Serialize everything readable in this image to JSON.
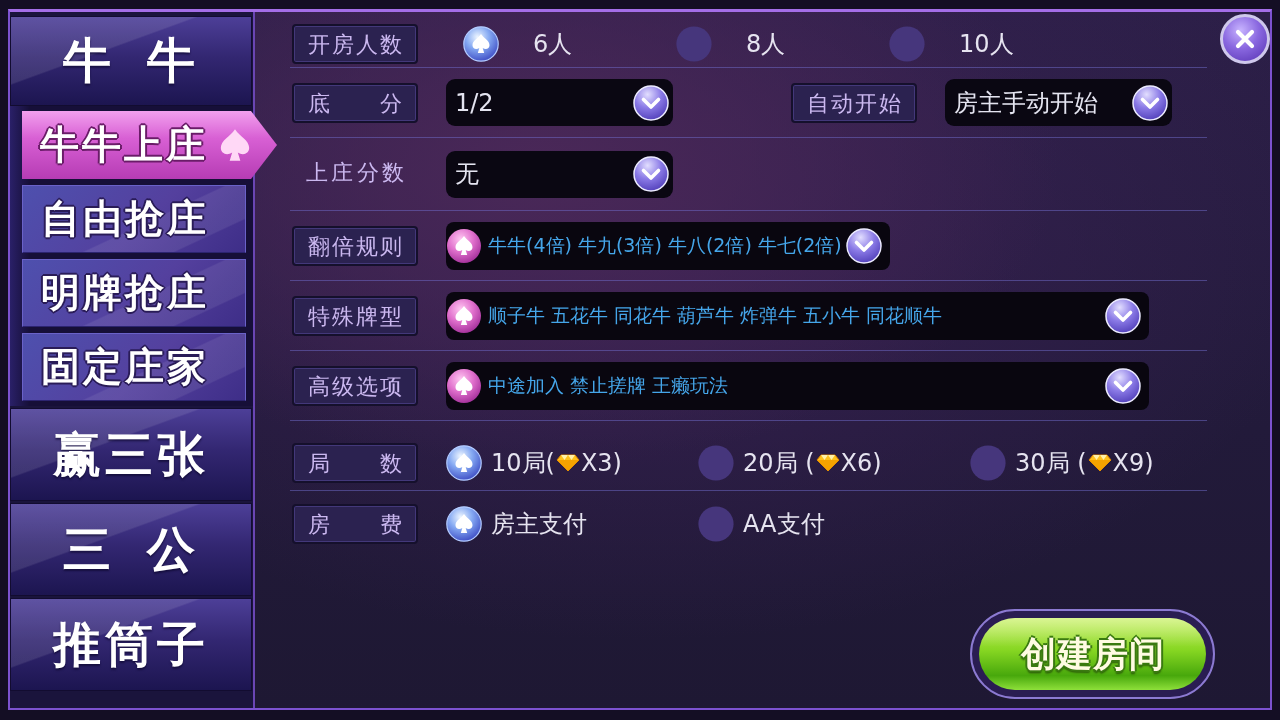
{
  "sidebar": [
    {
      "label": "牛 牛",
      "modes": [
        {
          "label": "牛牛上庄",
          "selected": true
        },
        {
          "label": "自由抢庄",
          "selected": false
        },
        {
          "label": "明牌抢庄",
          "selected": false
        },
        {
          "label": "固定庄家",
          "selected": false
        }
      ]
    },
    {
      "label": "赢三张"
    },
    {
      "label": "三 公"
    },
    {
      "label": "推筒子"
    }
  ],
  "settings": [
    {
      "fields": [
        {
          "kind": "radio",
          "label": "开房人数",
          "framed": true,
          "options": [
            {
              "label": "6人",
              "selected": true
            },
            {
              "label": "8人",
              "selected": false
            },
            {
              "label": "10人",
              "selected": false
            }
          ]
        }
      ]
    },
    {
      "fields": [
        {
          "kind": "select",
          "label": "底 分",
          "framed": true,
          "value": "1/2"
        },
        {
          "kind": "select",
          "label": "自动开始",
          "framed": true,
          "value": "房主手动开始"
        }
      ]
    },
    {
      "fields": [
        {
          "kind": "select",
          "label": "上庄分数",
          "framed": false,
          "value": "无"
        }
      ]
    },
    {
      "fields": [
        {
          "kind": "multi",
          "label": "翻倍规则",
          "framed": true,
          "stretch": false,
          "value": "牛牛(4倍) 牛九(3倍) 牛八(2倍) 牛七(2倍)"
        }
      ]
    },
    {
      "fields": [
        {
          "kind": "multi",
          "label": "特殊牌型",
          "framed": true,
          "stretch": true,
          "value": "顺子牛 五花牛 同花牛 葫芦牛 炸弹牛 五小牛 同花顺牛"
        }
      ]
    },
    {
      "fields": [
        {
          "kind": "multi",
          "label": "高级选项",
          "framed": true,
          "stretch": true,
          "value": "中途加入 禁止搓牌 王癞玩法"
        }
      ]
    },
    {
      "fields": [
        {
          "kind": "radio",
          "label": "局 数",
          "framed": true,
          "options": [
            {
              "label": "10局(",
              "cost": "X3)",
              "selected": true
            },
            {
              "label": "20局 (",
              "cost": "X6)",
              "selected": false
            },
            {
              "label": "30局 (",
              "cost": "X9)",
              "selected": false
            }
          ]
        }
      ]
    },
    {
      "fields": [
        {
          "kind": "radio",
          "label": "房 费",
          "framed": true,
          "options": [
            {
              "label": "房主支付",
              "selected": true
            },
            {
              "label": "AA支付",
              "selected": false
            }
          ]
        }
      ]
    }
  ],
  "create_button": {
    "label": "创建房间"
  }
}
